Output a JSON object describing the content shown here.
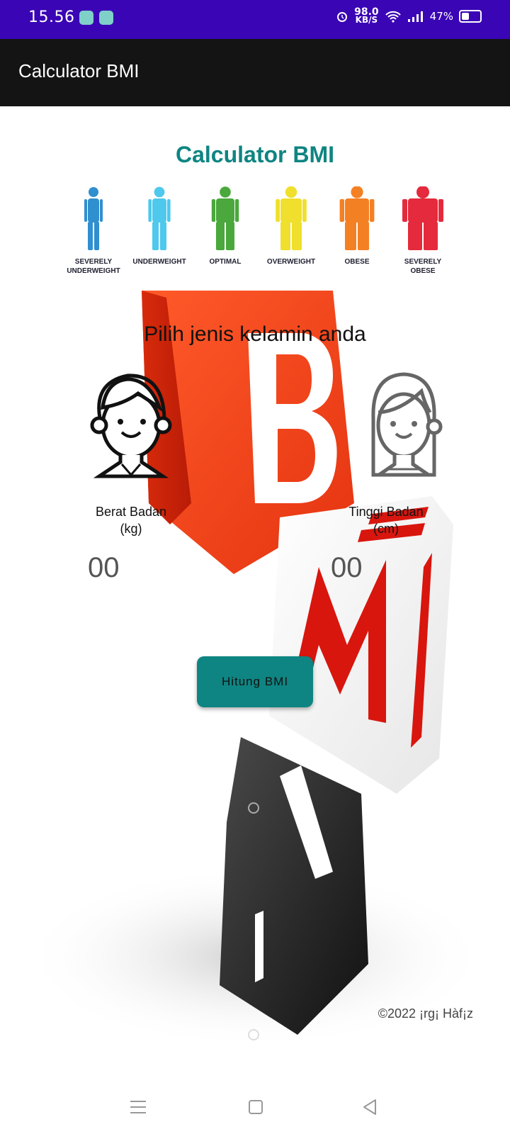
{
  "status_bar": {
    "time": "15.56",
    "net_speed_value": "98.0",
    "net_speed_unit": "KB/S",
    "battery": "47%",
    "icons": [
      "alarm-icon",
      "wifi-icon",
      "signal-icon",
      "battery-icon"
    ]
  },
  "app_bar": {
    "title": "Calculator BMI"
  },
  "main": {
    "heading": "Calculator BMI",
    "bmi_categories": [
      {
        "label_line1": "SEVERELY",
        "label_line2": "UNDERWEIGHT",
        "color": "#2f8fcf"
      },
      {
        "label_line1": "UNDERWEIGHT",
        "label_line2": "",
        "color": "#4fc8ee"
      },
      {
        "label_line1": "OPTIMAL",
        "label_line2": "",
        "color": "#4aa83c"
      },
      {
        "label_line1": "OVERWEIGHT",
        "label_line2": "",
        "color": "#f0df2c"
      },
      {
        "label_line1": "OBESE",
        "label_line2": "",
        "color": "#f48024"
      },
      {
        "label_line1": "SEVERELY",
        "label_line2": "OBESE",
        "color": "#e42a3c"
      }
    ],
    "gender_prompt": "Pilih jenis kelamin anda",
    "weight_label_line1": "Berat Badan",
    "weight_label_line2": "(kg)",
    "height_label_line1": "Tinggi Badan",
    "height_label_line2": "(cm)",
    "weight_placeholder": "00",
    "height_placeholder": "00",
    "calculate_button": "Hitung BMI",
    "copyright": "©2022 ¡rg¡ Hàf¡z"
  },
  "colors": {
    "status_bar": "#3a05b5",
    "app_bar": "#141414",
    "accent": "#0e8582"
  }
}
